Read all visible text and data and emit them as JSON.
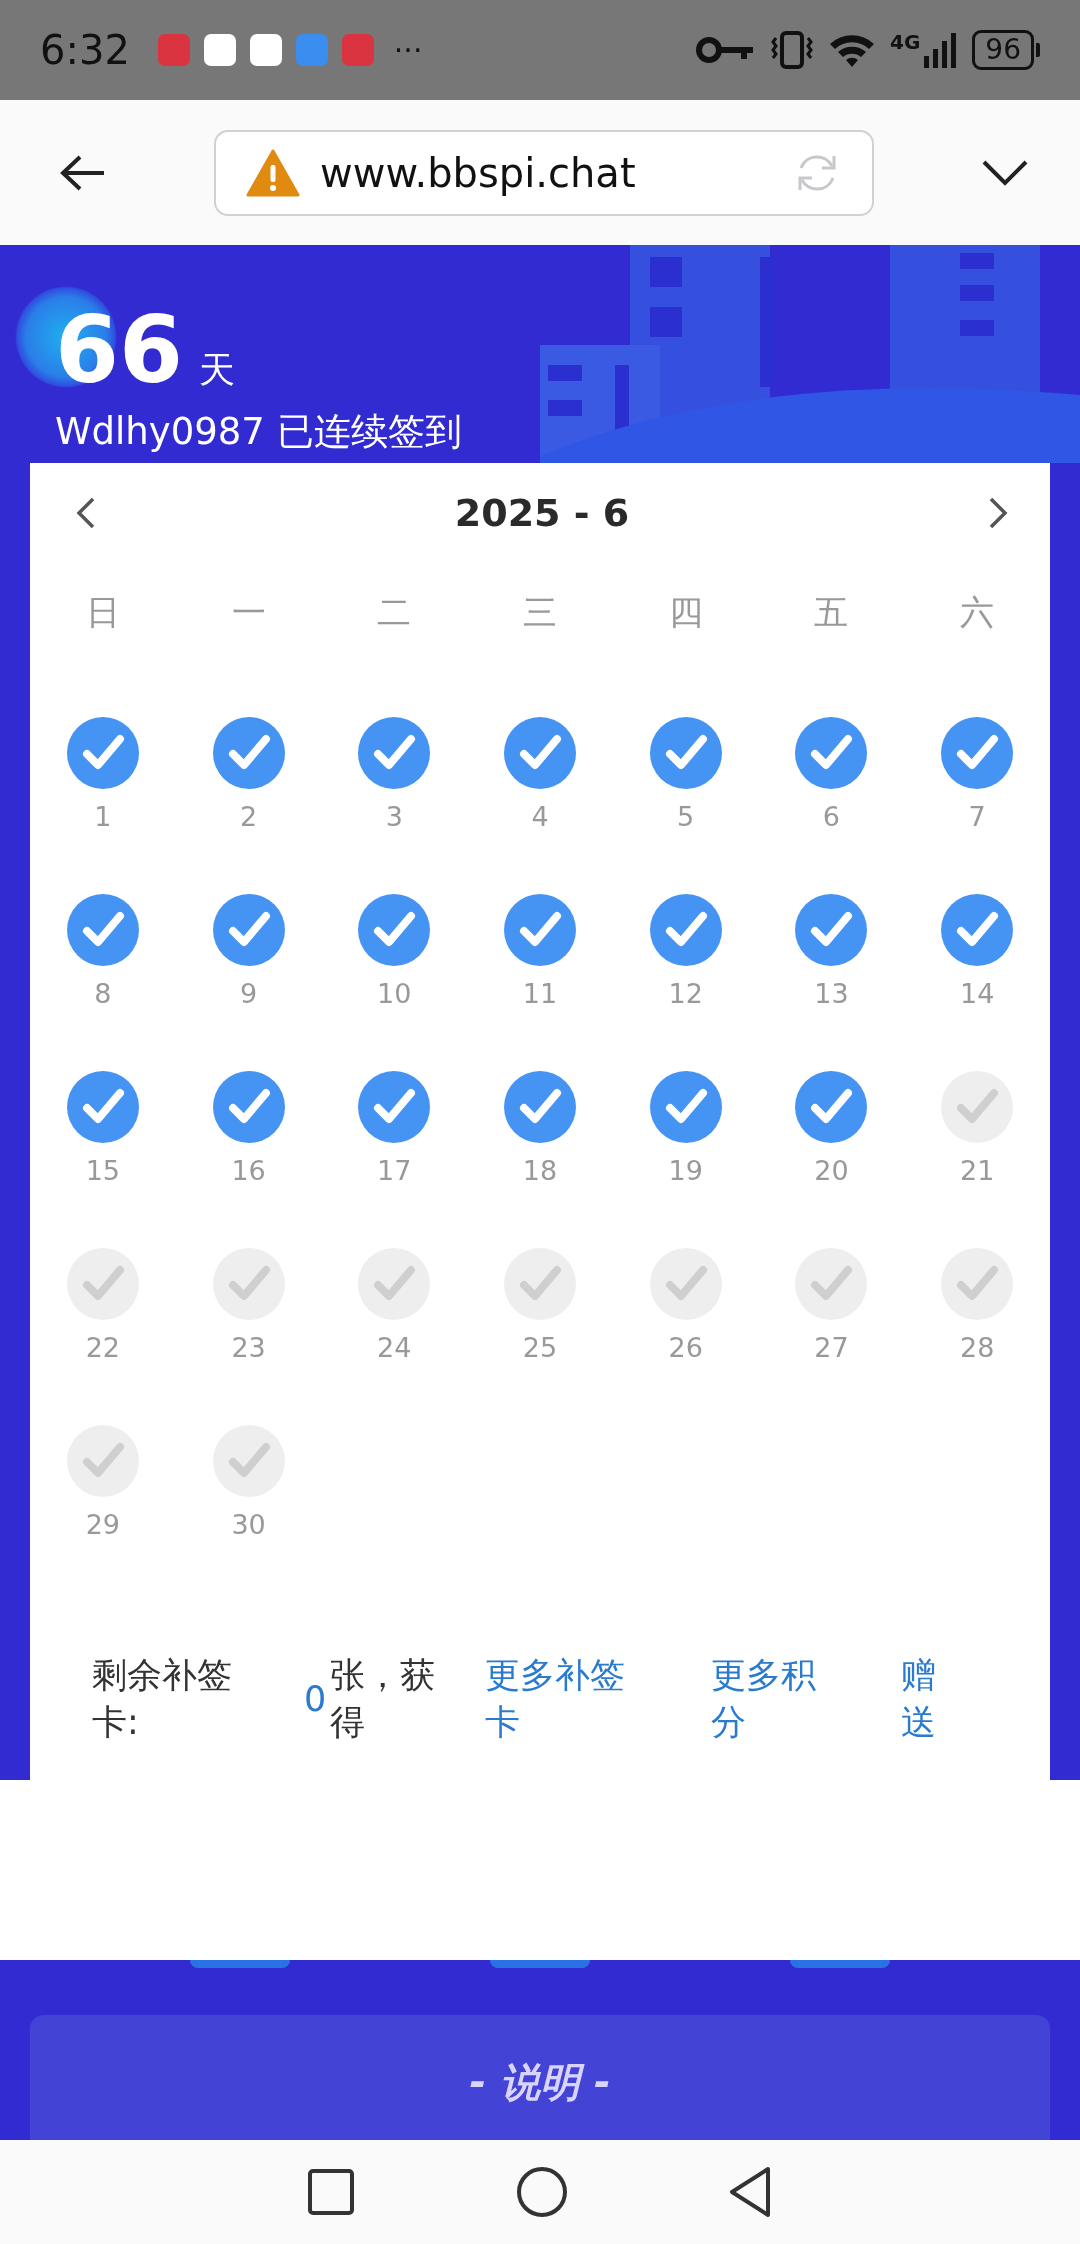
{
  "status_bar": {
    "time": "6:32",
    "more": "···",
    "network": "4G",
    "battery": "96"
  },
  "browser": {
    "url": "www.bbspi.chat"
  },
  "streak": {
    "days": "66",
    "unit": "天",
    "caption": "Wdlhy0987 已连续签到"
  },
  "calendar": {
    "title": "2025 - 6",
    "weekdays": [
      "日",
      "一",
      "二",
      "三",
      "四",
      "五",
      "六"
    ],
    "days": [
      {
        "label": "1",
        "checked": true
      },
      {
        "label": "2",
        "checked": true
      },
      {
        "label": "3",
        "checked": true
      },
      {
        "label": "4",
        "checked": true
      },
      {
        "label": "5",
        "checked": true
      },
      {
        "label": "6",
        "checked": true
      },
      {
        "label": "7",
        "checked": true
      },
      {
        "label": "8",
        "checked": true
      },
      {
        "label": "9",
        "checked": true
      },
      {
        "label": "10",
        "checked": true
      },
      {
        "label": "11",
        "checked": true
      },
      {
        "label": "12",
        "checked": true
      },
      {
        "label": "13",
        "checked": true
      },
      {
        "label": "14",
        "checked": true
      },
      {
        "label": "15",
        "checked": true
      },
      {
        "label": "16",
        "checked": true
      },
      {
        "label": "17",
        "checked": true
      },
      {
        "label": "18",
        "checked": true
      },
      {
        "label": "19",
        "checked": true
      },
      {
        "label": "20",
        "checked": true
      },
      {
        "label": "21",
        "checked": false
      },
      {
        "label": "22",
        "checked": false
      },
      {
        "label": "23",
        "checked": false
      },
      {
        "label": "24",
        "checked": false
      },
      {
        "label": "25",
        "checked": false
      },
      {
        "label": "26",
        "checked": false
      },
      {
        "label": "27",
        "checked": false
      },
      {
        "label": "28",
        "checked": false
      },
      {
        "label": "29",
        "checked": false
      },
      {
        "label": "30",
        "checked": false
      }
    ]
  },
  "makeup": {
    "label": "剩余补签卡:",
    "count": "0",
    "suffix": "张，获得",
    "links": [
      "更多补签卡",
      "更多积分",
      "赠送"
    ]
  },
  "notice": {
    "title": "- 说明 -"
  }
}
